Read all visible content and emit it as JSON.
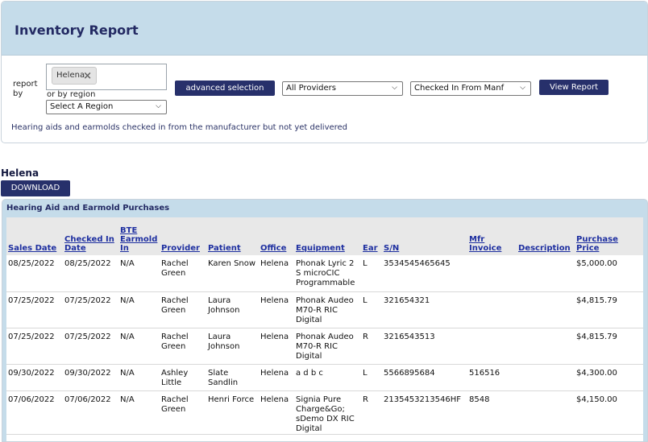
{
  "header": {
    "title": "Inventory Report"
  },
  "filters": {
    "report_by_label": "report by",
    "selected_tag": "Helena",
    "tag_remove": "×",
    "or_by_region_label": "or by region",
    "region_select": "Select A Region",
    "advanced_button": "advanced selection",
    "provider_select": "All Providers",
    "status_select": "Checked In From Manf",
    "view_button": "View Report",
    "description": "Hearing aids and earmolds checked in from the manufacturer but not yet delivered"
  },
  "location_heading": "Helena",
  "download_button": "DOWNLOAD",
  "section_title": "Hearing Aid and Earmold Purchases",
  "table": {
    "columns": [
      "Sales Date",
      "Checked In Date",
      "BTE Earmold In",
      "Provider",
      "Patient",
      "Office",
      "Equipment",
      "Ear",
      "S/N",
      "Mfr Invoice",
      "Description",
      "Purchase Price"
    ],
    "rows": [
      [
        "08/25/2022",
        "08/25/2022",
        "N/A",
        "Rachel Green",
        "Karen Snow",
        "Helena",
        "Phonak Lyric 2 S microCIC Programmable",
        "L",
        "3534545465645",
        "",
        "",
        "$5,000.00"
      ],
      [
        "07/25/2022",
        "07/25/2022",
        "N/A",
        "Rachel Green",
        "Laura Johnson",
        "Helena",
        "Phonak Audeo M70-R RIC Digital",
        "L",
        "321654321",
        "",
        "",
        "$4,815.79"
      ],
      [
        "07/25/2022",
        "07/25/2022",
        "N/A",
        "Rachel Green",
        "Laura Johnson",
        "Helena",
        "Phonak Audeo M70-R RIC Digital",
        "R",
        "3216543513",
        "",
        "",
        "$4,815.79"
      ],
      [
        "09/30/2022",
        "09/30/2022",
        "N/A",
        "Ashley Little",
        "Slate Sandlin",
        "Helena",
        "a d b c",
        "L",
        "5566895684",
        "516516",
        "",
        "$4,300.00"
      ],
      [
        "07/06/2022",
        "07/06/2022",
        "N/A",
        "Rachel Green",
        "Henri Force",
        "Helena",
        "Signia Pure Charge&Go; sDemo DX RIC Digital",
        "R",
        "2135453213546HF",
        "8548",
        "",
        "$4,150.00"
      ]
    ]
  },
  "icons": {
    "select_arrow": "chevron-down-icon",
    "remove": "close-icon"
  }
}
